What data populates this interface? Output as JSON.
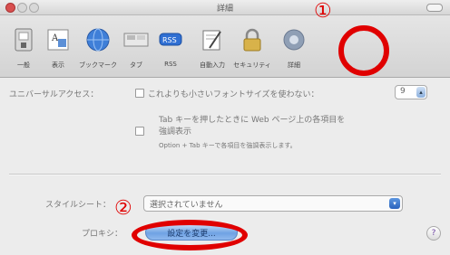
{
  "window": {
    "title": "詳細"
  },
  "toolbar": {
    "items": [
      {
        "label": "一般",
        "icon": "switch-icon"
      },
      {
        "label": "表示",
        "icon": "appearance-icon"
      },
      {
        "label": "ブックマーク",
        "icon": "globe-icon"
      },
      {
        "label": "タブ",
        "icon": "tabs-icon"
      },
      {
        "label": "RSS",
        "icon": "rss-icon"
      },
      {
        "label": "自動入力",
        "icon": "pencil-form-icon"
      },
      {
        "label": "セキュリティ",
        "icon": "lock-icon"
      },
      {
        "label": "詳細",
        "icon": "gear-icon"
      }
    ],
    "selected": "詳細"
  },
  "accessibility": {
    "label": "ユニバーサルアクセス：",
    "min_font_checkbox_label": "これよりも小さいフォントサイズを使わない：",
    "min_font_value": "9",
    "tab_checkbox_label_line1": "Tab キーを押したときに Web ページ上の各項目を",
    "tab_checkbox_label_line2": "強調表示",
    "tab_hint": "Option + Tab キーで各項目を強調表示します。"
  },
  "stylesheet": {
    "label": "スタイルシート：",
    "value": "選択されていません"
  },
  "proxy": {
    "label": "プロキシ：",
    "button_label": "設定を変更..."
  },
  "help": {
    "label": "?"
  },
  "annotations": {
    "marker1": "①",
    "marker2": "②"
  }
}
